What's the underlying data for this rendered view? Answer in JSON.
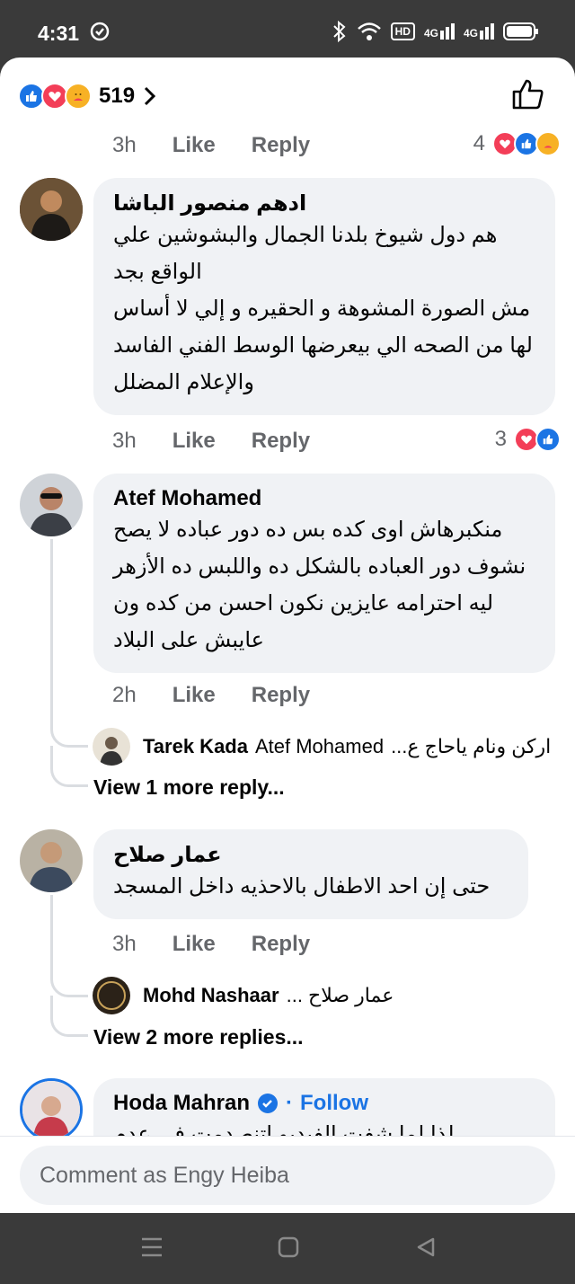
{
  "status": {
    "time": "4:31",
    "icons": [
      "sync-icon",
      "bluetooth-icon",
      "wifi-icon",
      "hd-icon",
      "signal-4g-icon",
      "signal-4g-icon",
      "battery-icon"
    ],
    "hd": "HD",
    "net1": "4G",
    "net2": "4G"
  },
  "header": {
    "reaction_count": "519",
    "reactions": [
      "like",
      "love",
      "care"
    ]
  },
  "comments": [
    {
      "time": "3h",
      "like": "Like",
      "reply": "Reply",
      "reaction_count": "4"
    },
    {
      "author": "ادهم منصور الباشا",
      "lines": [
        "هم دول شيوخ بلدنا الجمال والبشوشين علي",
        "الواقع بجد",
        "مش الصورة المشوهة و الحقيره و إلي لا أساس",
        "لها من الصحه الي بيعرضها الوسط الفني الفاسد",
        "والإعلام المضلل"
      ],
      "time": "3h",
      "like": "Like",
      "reply": "Reply",
      "reaction_count": "3"
    },
    {
      "author": "Atef Mohamed",
      "lines": [
        "منكبرهاش اوى كده بس ده دور عباده لا يصح",
        "نشوف دور العباده بالشكل ده واللبس ده الأزهر",
        "ليه احترامه عايزين نكون احسن من كده ون",
        "عايبش على البلاد"
      ],
      "time": "2h",
      "like": "Like",
      "reply": "Reply",
      "reply_preview": {
        "author": "Tarek Kada",
        "mention": "Atef Mohamed",
        "text": "اركن ونام ياحاج ع..."
      },
      "view_more": "View 1 more reply..."
    },
    {
      "author": "عمار صلاح",
      "lines": [
        "حتى إن احد الاطفال بالاحذيه داخل المسجد"
      ],
      "time": "3h",
      "like": "Like",
      "reply": "Reply",
      "reply_preview": {
        "author": "Mohd Nashaar",
        "mention": "",
        "text": "عمار صلاح ..."
      },
      "view_more": "View 2 more replies..."
    },
    {
      "author": "Hoda Mahran",
      "follow": "Follow",
      "lines": [
        "لذا لما شفت الفيديو اتنصدمت في عدم"
      ]
    }
  ],
  "composer": {
    "placeholder": "Comment as Engy Heiba"
  },
  "colors": {
    "accent": "#1b74e4",
    "love": "#f33e58",
    "care": "#f7b125"
  }
}
